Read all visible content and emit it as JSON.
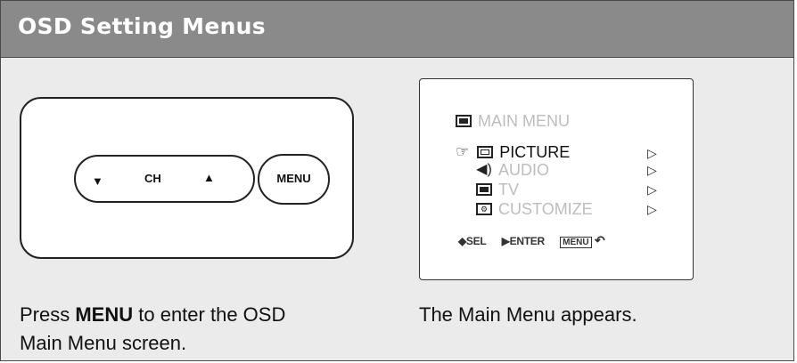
{
  "header": {
    "title": "OSD Setting Menus"
  },
  "remote": {
    "channel_label": "CH",
    "channel_down_glyph": "▼",
    "channel_up_glyph": "▲",
    "menu_label": "MENU"
  },
  "osd": {
    "main_title": "MAIN  MENU",
    "items": [
      {
        "label": "PICTURE",
        "selected": true
      },
      {
        "label": "AUDIO",
        "selected": false
      },
      {
        "label": "TV",
        "selected": false
      },
      {
        "label": "CUSTOMIZE",
        "selected": false
      }
    ],
    "footer": {
      "sel": "◆SEL",
      "enter": "▶ENTER",
      "menu": "MENU",
      "back_glyph": "↶"
    }
  },
  "captions": {
    "left_pre": "Press ",
    "left_bold": "MENU",
    "left_post": " to enter the OSD",
    "left_line2": "Main Menu screen.",
    "right": "The Main Menu appears."
  },
  "colors": {
    "header_bg": "#8a8a8a",
    "panel_bg": "#ebebeb",
    "menu_text_dim": "#bdbdbd"
  }
}
